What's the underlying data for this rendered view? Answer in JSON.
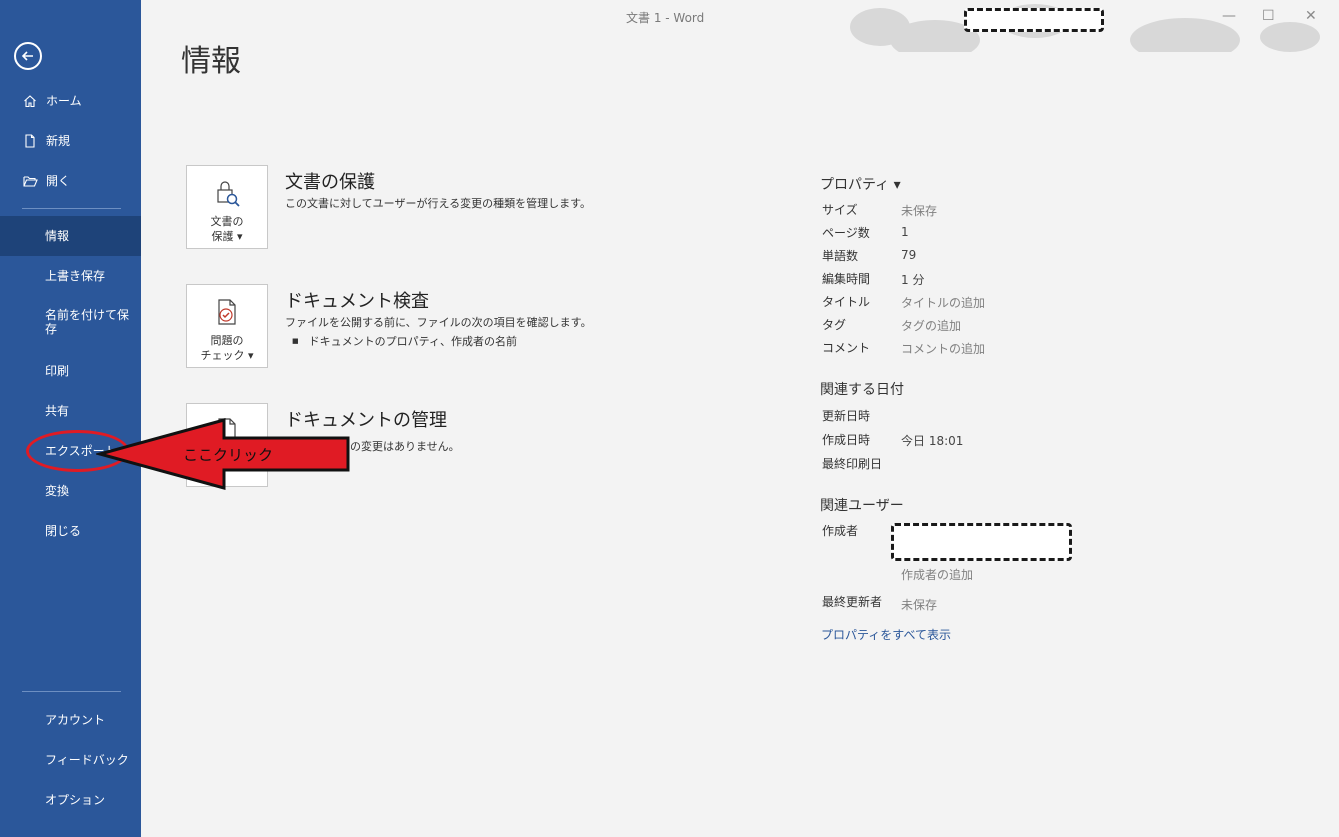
{
  "window": {
    "title": "文書 1  -  Word",
    "minimize_glyph": "—",
    "maximize_glyph": "☐",
    "close_glyph": "✕"
  },
  "sidebar": {
    "top_items": [
      {
        "label": "ホーム",
        "icon": "home-icon"
      },
      {
        "label": "新規",
        "icon": "new-document-icon"
      },
      {
        "label": "開く",
        "icon": "open-folder-icon"
      }
    ],
    "items": [
      {
        "label": "情報",
        "active": true
      },
      {
        "label": "上書き保存"
      },
      {
        "label": "名前を付けて保存"
      },
      {
        "label": "印刷"
      },
      {
        "label": "共有"
      },
      {
        "label": "エクスポート"
      },
      {
        "label": "変換"
      },
      {
        "label": "閉じる"
      }
    ],
    "bottom_items": [
      {
        "label": "アカウント"
      },
      {
        "label": "フィードバック"
      },
      {
        "label": "オプション"
      }
    ]
  },
  "main": {
    "heading": "情報",
    "sections": [
      {
        "tile_label_1": "文書の",
        "tile_label_2": "保護 ▾",
        "title": "文書の保護",
        "description": "この文書に対してユーザーが行える変更の種類を管理します。"
      },
      {
        "tile_label_1": "問題の",
        "tile_label_2": "チェック ▾",
        "title": "ドキュメント検査",
        "description": "ファイルを公開する前に、ファイルの次の項目を確認します。",
        "bullet": "ドキュメントのプロパティ、作成者の名前"
      },
      {
        "title": "ドキュメントの管理",
        "description_visible": "の変更はありません。"
      }
    ]
  },
  "properties": {
    "header": "プロパティ ▾",
    "rows": [
      {
        "key": "サイズ",
        "value": "未保存",
        "muted": true
      },
      {
        "key": "ページ数",
        "value": "1"
      },
      {
        "key": "単語数",
        "value": "79"
      },
      {
        "key": "編集時間",
        "value": "1 分"
      },
      {
        "key": "タイトル",
        "value": "タイトルの追加",
        "muted": true
      },
      {
        "key": "タグ",
        "value": "タグの追加",
        "muted": true
      },
      {
        "key": "コメント",
        "value": "コメントの追加",
        "muted": true
      }
    ],
    "dates_header": "関連する日付",
    "dates": [
      {
        "key": "更新日時",
        "value": ""
      },
      {
        "key": "作成日時",
        "value": "今日 18:01"
      },
      {
        "key": "最終印刷日",
        "value": ""
      }
    ],
    "people_header": "関連ユーザー",
    "author_key": "作成者",
    "author_add": "作成者の追加",
    "last_modified_key": "最終更新者",
    "last_modified_value": "未保存",
    "show_all_link": "プロパティをすべて表示"
  },
  "annotation": {
    "text": "ここクリック",
    "color": "#e01b24"
  },
  "colors": {
    "sidebar": "#2b579a",
    "sidebar_active": "#1e4379",
    "background": "#f3f3f3",
    "link": "#2b579a"
  }
}
